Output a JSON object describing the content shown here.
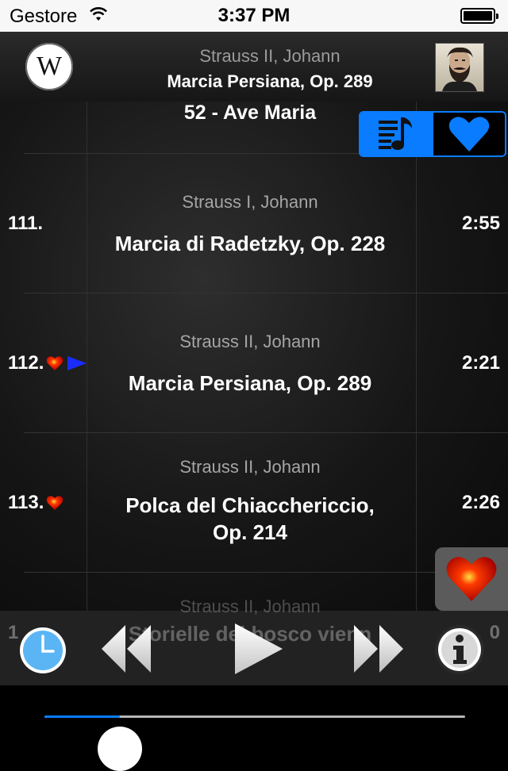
{
  "status_bar": {
    "carrier": "Gestore",
    "time": "3:37 PM"
  },
  "now_playing": {
    "composer": "Strauss II, Johann",
    "title": "Marcia Persiana, Op. 289",
    "wiki_glyph": "W"
  },
  "album": {
    "title": "52 - Ave Maria"
  },
  "tracks": [
    {
      "number": "111.",
      "composer": "Strauss I, Johann",
      "title": "Marcia di Radetzky, Op. 228",
      "duration": "2:55",
      "favorite": false,
      "playing": false
    },
    {
      "number": "112.",
      "composer": "Strauss II, Johann",
      "title": "Marcia Persiana, Op. 289",
      "duration": "2:21",
      "favorite": true,
      "playing": true
    },
    {
      "number": "113.",
      "composer": "Strauss II, Johann",
      "title": "Polca del Chiacchericcio,\nOp. 214",
      "duration": "2:26",
      "favorite": true,
      "playing": false
    },
    {
      "number": "1",
      "composer": "Strauss II, Johann",
      "title": "Storielle del bosco vienn",
      "duration": "0",
      "favorite": false,
      "playing": false
    }
  ],
  "player": {
    "progress": 0.18
  },
  "colors": {
    "accent": "#0a7cff",
    "heart": "#e01010"
  },
  "icons": {
    "wikipedia": "wikipedia-icon",
    "playlist": "playlist-icon",
    "favorites": "heart-icon",
    "timer": "clock-icon",
    "previous": "rewind-icon",
    "play": "play-icon",
    "next": "fast-forward-icon",
    "info": "info-icon"
  }
}
